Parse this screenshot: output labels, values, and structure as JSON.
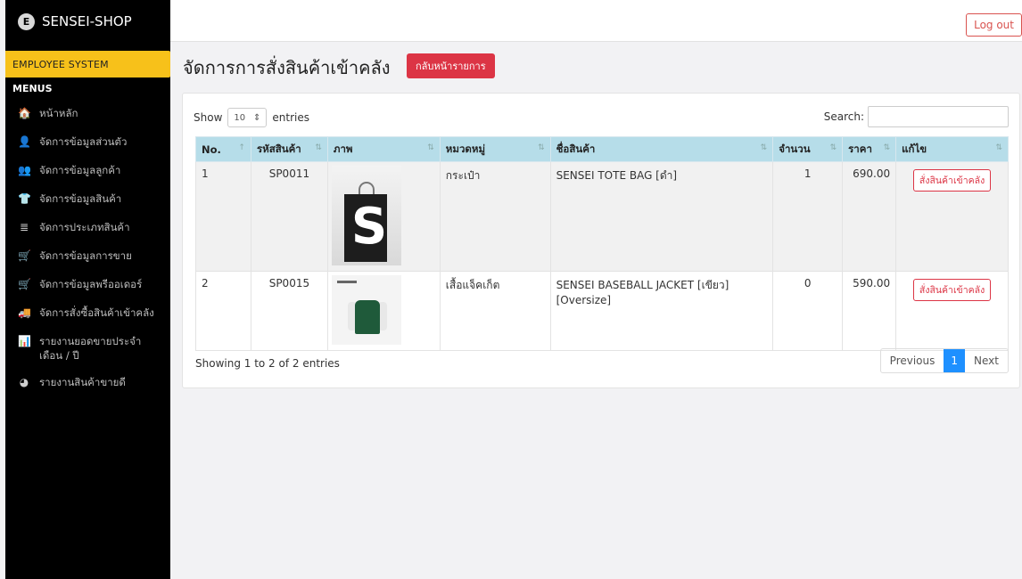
{
  "brand": {
    "logo_letter": "E",
    "name": "SENSEI-SHOP"
  },
  "sidebar": {
    "system_label": "EMPLOYEE SYSTEM",
    "menus_label": "MENUS",
    "items": [
      {
        "icon": "home-icon",
        "glyph": "🏠",
        "label": "หน้าหลัก"
      },
      {
        "icon": "user-icon",
        "glyph": "👤",
        "label": "จัดการข้อมูลส่วนตัว"
      },
      {
        "icon": "users-icon",
        "glyph": "👥",
        "label": "จัดการข้อมูลลูกค้า"
      },
      {
        "icon": "shirt-icon",
        "glyph": "👕",
        "label": "จัดการข้อมูลสินค้า"
      },
      {
        "icon": "list-icon",
        "glyph": "≣",
        "label": "จัดการประเภทสินค้า"
      },
      {
        "icon": "cart-icon",
        "glyph": "🛒",
        "label": "จัดการข้อมูลการขาย"
      },
      {
        "icon": "cart-icon",
        "glyph": "🛒",
        "label": "จัดการข้อมูลพรีออเดอร์"
      },
      {
        "icon": "truck-icon",
        "glyph": "🚚",
        "label": "จัดการสั่งซื้อสินค้าเข้าคลัง"
      },
      {
        "icon": "chart-icon",
        "glyph": "📊",
        "label": "รายงานยอดขายประจำเดือน / ปี"
      },
      {
        "icon": "pie-chart-icon",
        "glyph": "◕",
        "label": "รายงานสินค้าขายดี"
      }
    ]
  },
  "topbar": {
    "logout_label": "Log out"
  },
  "page": {
    "title": "จัดการการสั่งสินค้าเข้าคลัง",
    "back_label": "กลับหน้ารายการ"
  },
  "table_controls": {
    "show_label": "Show",
    "show_value": "10",
    "entries_label": "entries",
    "search_label": "Search:",
    "search_value": ""
  },
  "table": {
    "headers": [
      "No.",
      "รหัสสินค้า",
      "ภาพ",
      "หมวดหมู่",
      "ชื่อสินค้า",
      "จำนวน",
      "ราคา",
      "แก้ไข"
    ],
    "rows": [
      {
        "no": "1",
        "code": "SP0011",
        "image": "tote-bag-image",
        "category": "กระเป๋า",
        "name": "SENSEI TOTE BAG [ดำ]",
        "qty": "1",
        "price": "690.00",
        "action": "สั่งสินค้าเข้าคลัง"
      },
      {
        "no": "2",
        "code": "SP0015",
        "image": "jacket-image",
        "category": "เสื้อแจ็คเก็ต",
        "name": "SENSEI BASEBALL JACKET [เขียว] [Oversize]",
        "qty": "0",
        "price": "590.00",
        "action": "สั่งสินค้าเข้าคลัง"
      }
    ]
  },
  "footer": {
    "info": "Showing 1 to 2 of 2 entries",
    "previous": "Previous",
    "page": "1",
    "next": "Next"
  },
  "colors": {
    "sidebar_bg": "#000000",
    "accent_yellow": "#f7c11a",
    "danger": "#dc3545",
    "table_header": "#b6dde9",
    "pager_active": "#1e90ff"
  }
}
